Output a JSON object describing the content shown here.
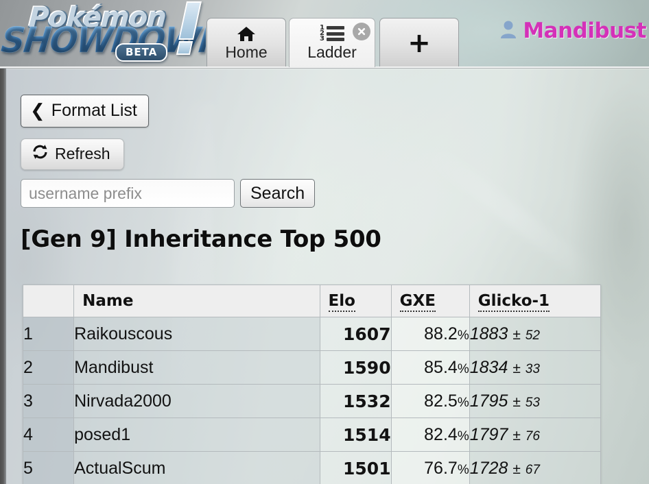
{
  "app": {
    "logo": {
      "line1": "Pokémon",
      "line2": "SHOWDOWN",
      "badge": "BETA"
    }
  },
  "tabs": [
    {
      "id": "home",
      "label": "Home",
      "icon": "home-icon",
      "active": false,
      "closable": false
    },
    {
      "id": "ladder",
      "label": "Ladder",
      "icon": "ordered-list-icon",
      "active": true,
      "closable": true
    },
    {
      "id": "new",
      "label": "+",
      "icon": "plus-icon",
      "active": false,
      "closable": false
    }
  ],
  "user": {
    "name": "Mandibust",
    "icon": "user-avatar-icon",
    "color": "#d431b8"
  },
  "toolbar": {
    "format_list_label": "Format List",
    "format_list_icon": "chevron-left-icon",
    "refresh_label": "Refresh",
    "refresh_icon": "refresh-icon"
  },
  "search": {
    "placeholder": "username prefix",
    "value": "",
    "button_label": "Search"
  },
  "page": {
    "title": "[Gen 9] Inheritance Top 500"
  },
  "table": {
    "headers": {
      "rank": "",
      "name": "Name",
      "elo": "Elo",
      "gxe": "GXE",
      "glicko": "Glicko-1"
    },
    "rows": [
      {
        "rank": "1",
        "name": "Raikouscous",
        "elo": "1607",
        "gxe": "88.2",
        "gxe_suffix": "%",
        "glicko": "1883",
        "pm": "±",
        "deviation": "52"
      },
      {
        "rank": "2",
        "name": "Mandibust",
        "elo": "1590",
        "gxe": "85.4",
        "gxe_suffix": "%",
        "glicko": "1834",
        "pm": "±",
        "deviation": "33"
      },
      {
        "rank": "3",
        "name": "Nirvada2000",
        "elo": "1532",
        "gxe": "82.5",
        "gxe_suffix": "%",
        "glicko": "1795",
        "pm": "±",
        "deviation": "53"
      },
      {
        "rank": "4",
        "name": "posed1",
        "elo": "1514",
        "gxe": "82.4",
        "gxe_suffix": "%",
        "glicko": "1797",
        "pm": "±",
        "deviation": "76"
      },
      {
        "rank": "5",
        "name": "ActualScum",
        "elo": "1501",
        "gxe": "76.7",
        "gxe_suffix": "%",
        "glicko": "1728",
        "pm": "±",
        "deviation": "67"
      }
    ]
  }
}
